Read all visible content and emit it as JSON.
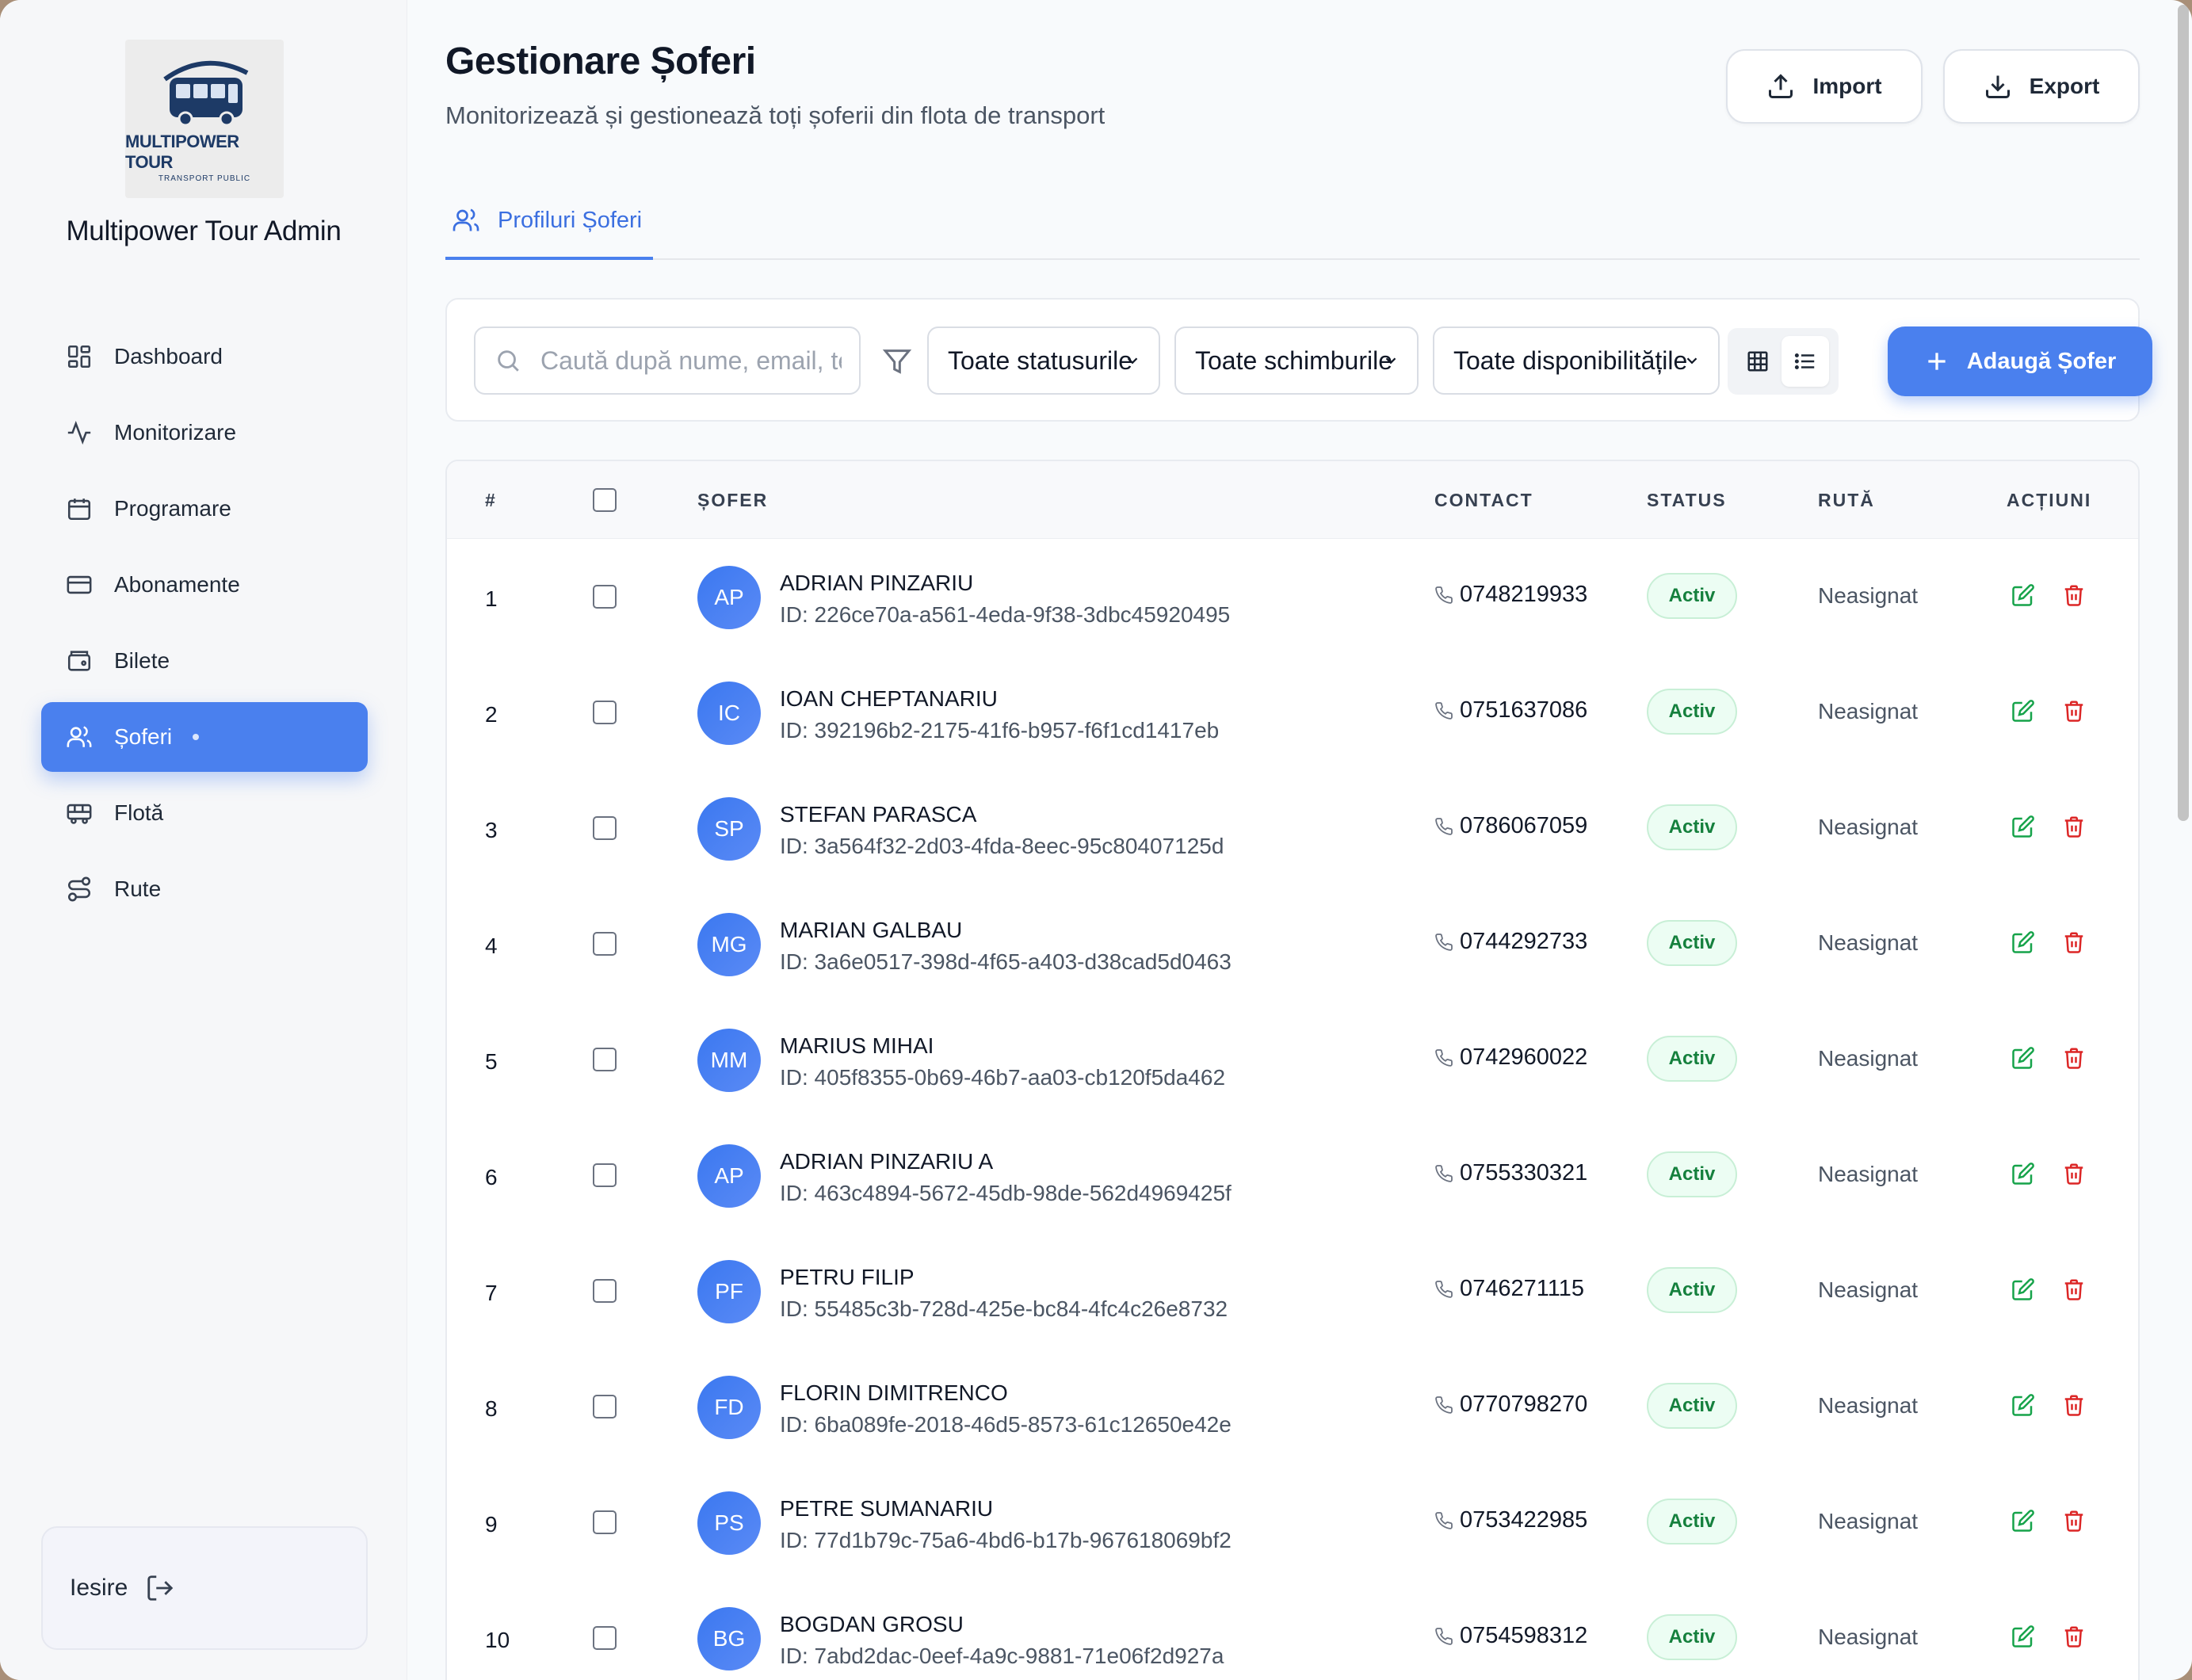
{
  "sidebar": {
    "logo_brand": "MULTIPOWER TOUR",
    "logo_sub": "TRANSPORT PUBLIC",
    "app_title": "Multipower Tour Admin",
    "items": [
      {
        "label": "Dashboard",
        "icon": "dashboard-icon"
      },
      {
        "label": "Monitorizare",
        "icon": "activity-icon"
      },
      {
        "label": "Programare",
        "icon": "calendar-icon"
      },
      {
        "label": "Abonamente",
        "icon": "card-icon"
      },
      {
        "label": "Bilete",
        "icon": "ticket-icon"
      },
      {
        "label": "Șoferi",
        "icon": "users-icon",
        "active": true
      },
      {
        "label": "Flotă",
        "icon": "bus-icon"
      },
      {
        "label": "Rute",
        "icon": "route-icon"
      }
    ],
    "logout_label": "Iesire"
  },
  "header": {
    "title": "Gestionare Șoferi",
    "subtitle": "Monitorizează și gestionează toți șoferii din flota de transport",
    "import_label": "Import",
    "export_label": "Export"
  },
  "tabs": [
    {
      "label": "Profiluri Șoferi",
      "active": true
    }
  ],
  "filters": {
    "search_placeholder": "Caută după nume, email, telefon...",
    "status_select": "Toate statusurile",
    "shift_select": "Toate schimburile",
    "availability_select": "Toate disponibilitățile",
    "add_label": "Adaugă Șofer"
  },
  "table": {
    "headers": {
      "num": "#",
      "driver": "ȘOFER",
      "contact": "CONTACT",
      "status": "STATUS",
      "route": "RUTĂ",
      "actions": "ACȚIUNI"
    },
    "rows": [
      {
        "num": "1",
        "initials": "AP",
        "name": "ADRIAN PINZARIU",
        "id": "ID: 226ce70a-a561-4eda-9f38-3dbc45920495",
        "phone": "0748219933",
        "status": "Activ",
        "route": "Neasignat"
      },
      {
        "num": "2",
        "initials": "IC",
        "name": "IOAN CHEPTANARIU",
        "id": "ID: 392196b2-2175-41f6-b957-f6f1cd1417eb",
        "phone": "0751637086",
        "status": "Activ",
        "route": "Neasignat"
      },
      {
        "num": "3",
        "initials": "SP",
        "name": "STEFAN PARASCA",
        "id": "ID: 3a564f32-2d03-4fda-8eec-95c80407125d",
        "phone": "0786067059",
        "status": "Activ",
        "route": "Neasignat"
      },
      {
        "num": "4",
        "initials": "MG",
        "name": "MARIAN GALBAU",
        "id": "ID: 3a6e0517-398d-4f65-a403-d38cad5d0463",
        "phone": "0744292733",
        "status": "Activ",
        "route": "Neasignat"
      },
      {
        "num": "5",
        "initials": "MM",
        "name": "MARIUS MIHAI",
        "id": "ID: 405f8355-0b69-46b7-aa03-cb120f5da462",
        "phone": "0742960022",
        "status": "Activ",
        "route": "Neasignat"
      },
      {
        "num": "6",
        "initials": "AP",
        "name": "ADRIAN PINZARIU A",
        "id": "ID: 463c4894-5672-45db-98de-562d4969425f",
        "phone": "0755330321",
        "status": "Activ",
        "route": "Neasignat"
      },
      {
        "num": "7",
        "initials": "PF",
        "name": "PETRU FILIP",
        "id": "ID: 55485c3b-728d-425e-bc84-4fc4c26e8732",
        "phone": "0746271115",
        "status": "Activ",
        "route": "Neasignat"
      },
      {
        "num": "8",
        "initials": "FD",
        "name": "FLORIN DIMITRENCO",
        "id": "ID: 6ba089fe-2018-46d5-8573-61c12650e42e",
        "phone": "0770798270",
        "status": "Activ",
        "route": "Neasignat"
      },
      {
        "num": "9",
        "initials": "PS",
        "name": "PETRE SUMANARIU",
        "id": "ID: 77d1b79c-75a6-4bd6-b17b-967618069bf2",
        "phone": "0753422985",
        "status": "Activ",
        "route": "Neasignat"
      },
      {
        "num": "10",
        "initials": "BG",
        "name": "BOGDAN GROSU",
        "id": "ID: 7abd2dac-0eef-4a9c-9881-71e06f2d927a",
        "phone": "0754598312",
        "status": "Activ",
        "route": "Neasignat"
      }
    ]
  },
  "colors": {
    "accent": "#4a80ee",
    "active_green": "#15803d",
    "delete_red": "#dc2626",
    "edit_green": "#16a34a"
  }
}
